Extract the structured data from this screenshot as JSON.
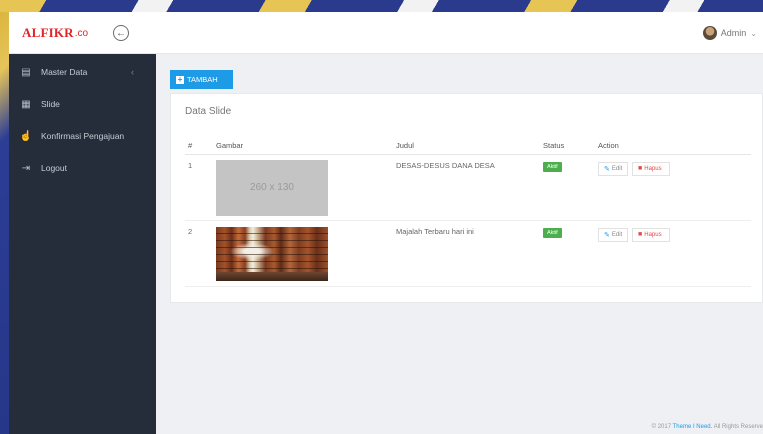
{
  "brand": {
    "name": "ALFIKR",
    "suffix": ".co"
  },
  "header": {
    "user_name": "Admin"
  },
  "sidebar": {
    "items": [
      {
        "label": "Master Data",
        "icon": "database-icon",
        "has_chevron": true
      },
      {
        "label": "Slide",
        "icon": "image-icon",
        "has_chevron": false
      },
      {
        "label": "Konfirmasi Pengajuan",
        "icon": "thumbs-up-icon",
        "has_chevron": false
      },
      {
        "label": "Logout",
        "icon": "logout-icon",
        "has_chevron": false
      }
    ]
  },
  "main": {
    "add_button_label": "TAMBAH",
    "panel_title": "Data Slide",
    "table": {
      "headers": [
        "#",
        "Gambar",
        "Judul",
        "Status",
        "Action"
      ],
      "rows": [
        {
          "no": "1",
          "image": {
            "kind": "placeholder",
            "text": "260 x 130"
          },
          "judul": "DESAS-DESUS DANA DESA",
          "status": "Aktif",
          "edit_label": "Edit",
          "delete_label": "Hapus"
        },
        {
          "no": "2",
          "image": {
            "kind": "photo",
            "subject": "library bookshelves"
          },
          "judul": "Majalah Terbaru hari ini",
          "status": "Aktif",
          "edit_label": "Edit",
          "delete_label": "Hapus"
        }
      ]
    }
  },
  "footer": {
    "prefix": "© 2017",
    "link_text": "Theme I Need.",
    "suffix": "All Rights Reserve"
  },
  "colors": {
    "brand": "#e02428",
    "accent": "#1e9be6",
    "sidebar_bg": "#252d3a",
    "status_active": "#4cae4c",
    "danger": "#e14b4b"
  }
}
